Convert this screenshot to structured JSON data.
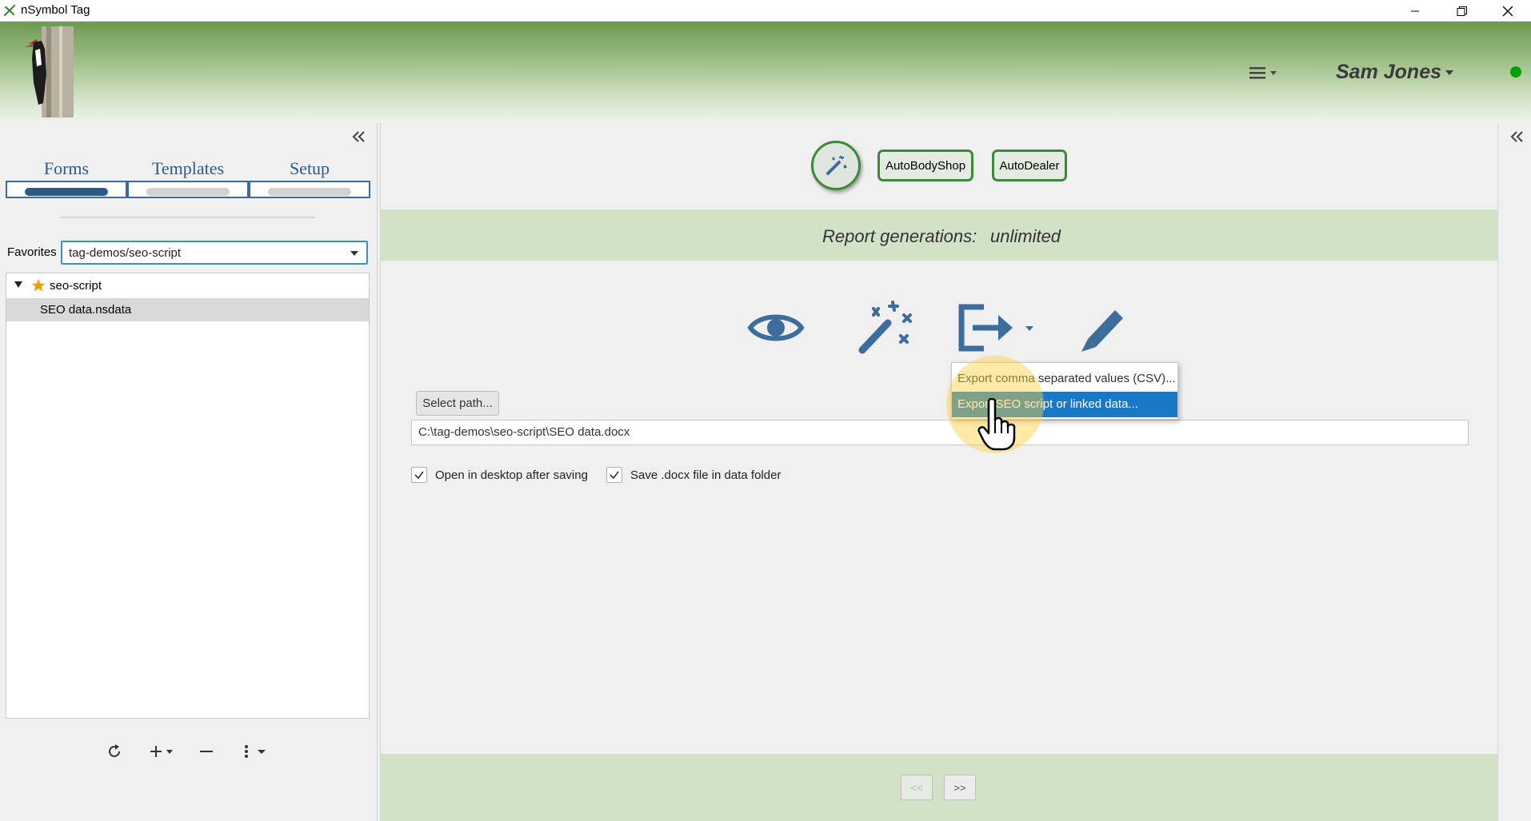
{
  "window": {
    "title": "nSymbol Tag"
  },
  "header": {
    "user_name": "Sam Jones",
    "status_color": "#00a000",
    "accent_color": "#2e5a8a",
    "green_accent": "#3a8a3a"
  },
  "left": {
    "tabs": [
      {
        "label": "Forms",
        "active": true
      },
      {
        "label": "Templates",
        "active": false
      },
      {
        "label": "Setup",
        "active": false
      }
    ],
    "favorites_label": "Favorites",
    "favorites_value": "tag-demos/seo-script",
    "tree": {
      "folder": "seo-script",
      "file": "SEO data.nsdata"
    }
  },
  "main": {
    "chips": [
      "AutoBodyShop",
      "AutoDealer"
    ],
    "report_label": "Report generations:",
    "report_value": "unlimited",
    "select_path_label": "Select path...",
    "path_value": "C:\\tag-demos\\seo-script\\SEO data.docx",
    "checkboxes": [
      {
        "label": "Open in desktop after saving",
        "checked": true
      },
      {
        "label": "Save .docx file in data folder",
        "checked": true
      }
    ],
    "export_menu": [
      "Export comma separated values (CSV)...",
      "Export SEO script or linked data..."
    ],
    "nav": {
      "prev": "<<",
      "next": ">>"
    }
  }
}
